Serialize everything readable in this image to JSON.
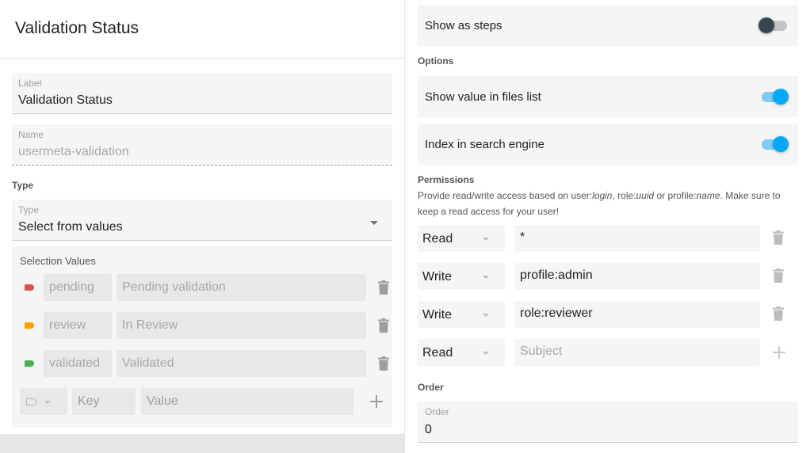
{
  "left": {
    "title": "Validation Status",
    "label_field": {
      "label": "Label",
      "value": "Validation Status"
    },
    "name_field": {
      "label": "Name",
      "value": "usermeta-validation"
    },
    "type_section_title": "Type",
    "type_field": {
      "label": "Type",
      "value": "Select from values"
    },
    "selection_values": {
      "title": "Selection Values",
      "rows": [
        {
          "key": "pending",
          "value": "Pending validation",
          "color": "#d9534f"
        },
        {
          "key": "review",
          "value": "In Review",
          "color": "#ffa000"
        },
        {
          "key": "validated",
          "value": "Validated",
          "color": "#4caf50"
        }
      ],
      "new_row": {
        "key_placeholder": "Key",
        "value_placeholder": "Value"
      }
    }
  },
  "right": {
    "show_as_steps": {
      "label": "Show as steps",
      "on": false
    },
    "options_title": "Options",
    "show_in_files_list": {
      "label": "Show value in files list",
      "on": true
    },
    "index_search": {
      "label": "Index in search engine",
      "on": true
    },
    "permissions": {
      "title": "Permissions",
      "desc_1": "Provide read/write access based on user:",
      "desc_login": "login",
      "desc_2": ", role:",
      "desc_uuid": "uuid",
      "desc_3": " or profile:",
      "desc_name": "name",
      "desc_4": ". Make sure to keep a read access for your user!",
      "rows": [
        {
          "access": "Read",
          "subject": "*"
        },
        {
          "access": "Write",
          "subject": "profile:admin"
        },
        {
          "access": "Write",
          "subject": "role:reviewer"
        }
      ],
      "new_row": {
        "access": "Read",
        "subject_placeholder": "Subject"
      }
    },
    "order": {
      "section_title": "Order",
      "label": "Order",
      "value": "0"
    }
  },
  "colors": {
    "accent": "#03a9f4",
    "panel": "#f5f5f6"
  }
}
